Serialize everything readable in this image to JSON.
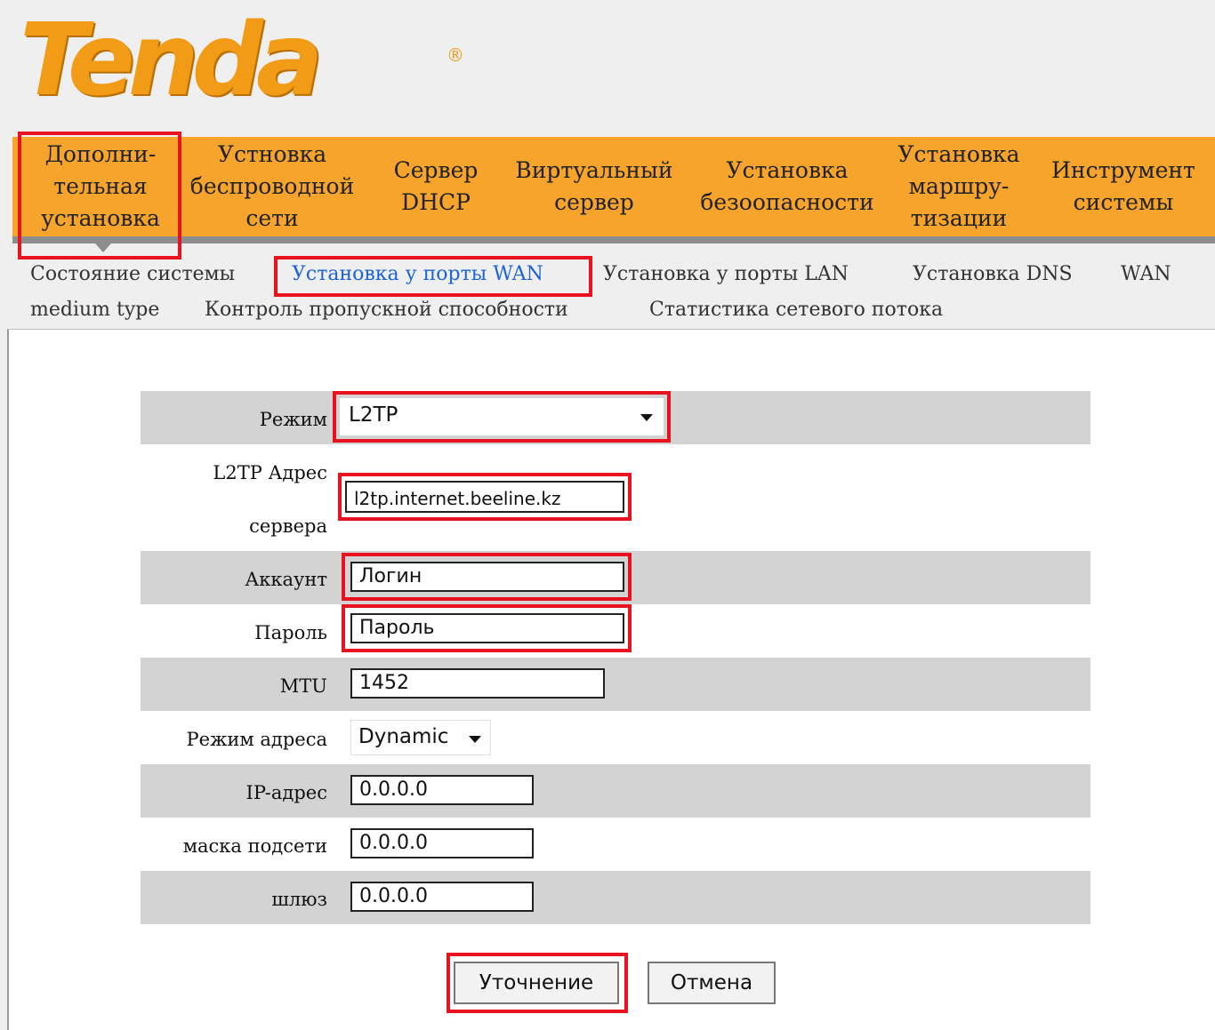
{
  "brand": {
    "logo_text": "Tenda",
    "reg_mark": "®"
  },
  "main_nav": {
    "items": [
      {
        "label": "Дополни-\nтельная\nустановка"
      },
      {
        "label": "Устновка\nбеспроводной\nсети"
      },
      {
        "label": "Сервер\nDHCP"
      },
      {
        "label": "Виртуальный\nсервер"
      },
      {
        "label": "Установка\nбезоопасности"
      },
      {
        "label": "Установка\nмаршру-\nтизации"
      },
      {
        "label": "Инструмент\nсистемы"
      }
    ]
  },
  "sub_nav": {
    "items": [
      {
        "label": "Состояние системы"
      },
      {
        "label": "Установка у порты WAN"
      },
      {
        "label": "Установка у порты LAN"
      },
      {
        "label": "Установка DNS"
      },
      {
        "label": "WAN"
      },
      {
        "label": "medium type"
      },
      {
        "label": "Контроль пропускной способности"
      },
      {
        "label": "Статистика сетевого потока"
      }
    ]
  },
  "form": {
    "mode_label": "Режим",
    "mode_value": "L2TP",
    "server_label_1": "L2TP Адрес",
    "server_label_2": "сервера",
    "server_value": "l2tp.internet.beeline.kz",
    "account_label": "Аккаунт",
    "account_value": "Логин",
    "password_label": "Пароль",
    "password_value": "Пароль",
    "mtu_label": "MTU",
    "mtu_value": "1452",
    "addr_mode_label": "Режим адреса",
    "addr_mode_value": "Dynamic",
    "ip_label": "IP-адрес",
    "ip_value": "0.0.0.0",
    "mask_label": "маска подсети",
    "mask_value": "0.0.0.0",
    "gateway_label": "шлюз",
    "gateway_value": "0.0.0.0"
  },
  "buttons": {
    "save": "Уточнение",
    "cancel": "Отмена"
  },
  "colors": {
    "accent": "#f6a42b",
    "highlight": "#e8131f",
    "active_link": "#1b63d8",
    "row_shade": "#d3d3d3"
  }
}
